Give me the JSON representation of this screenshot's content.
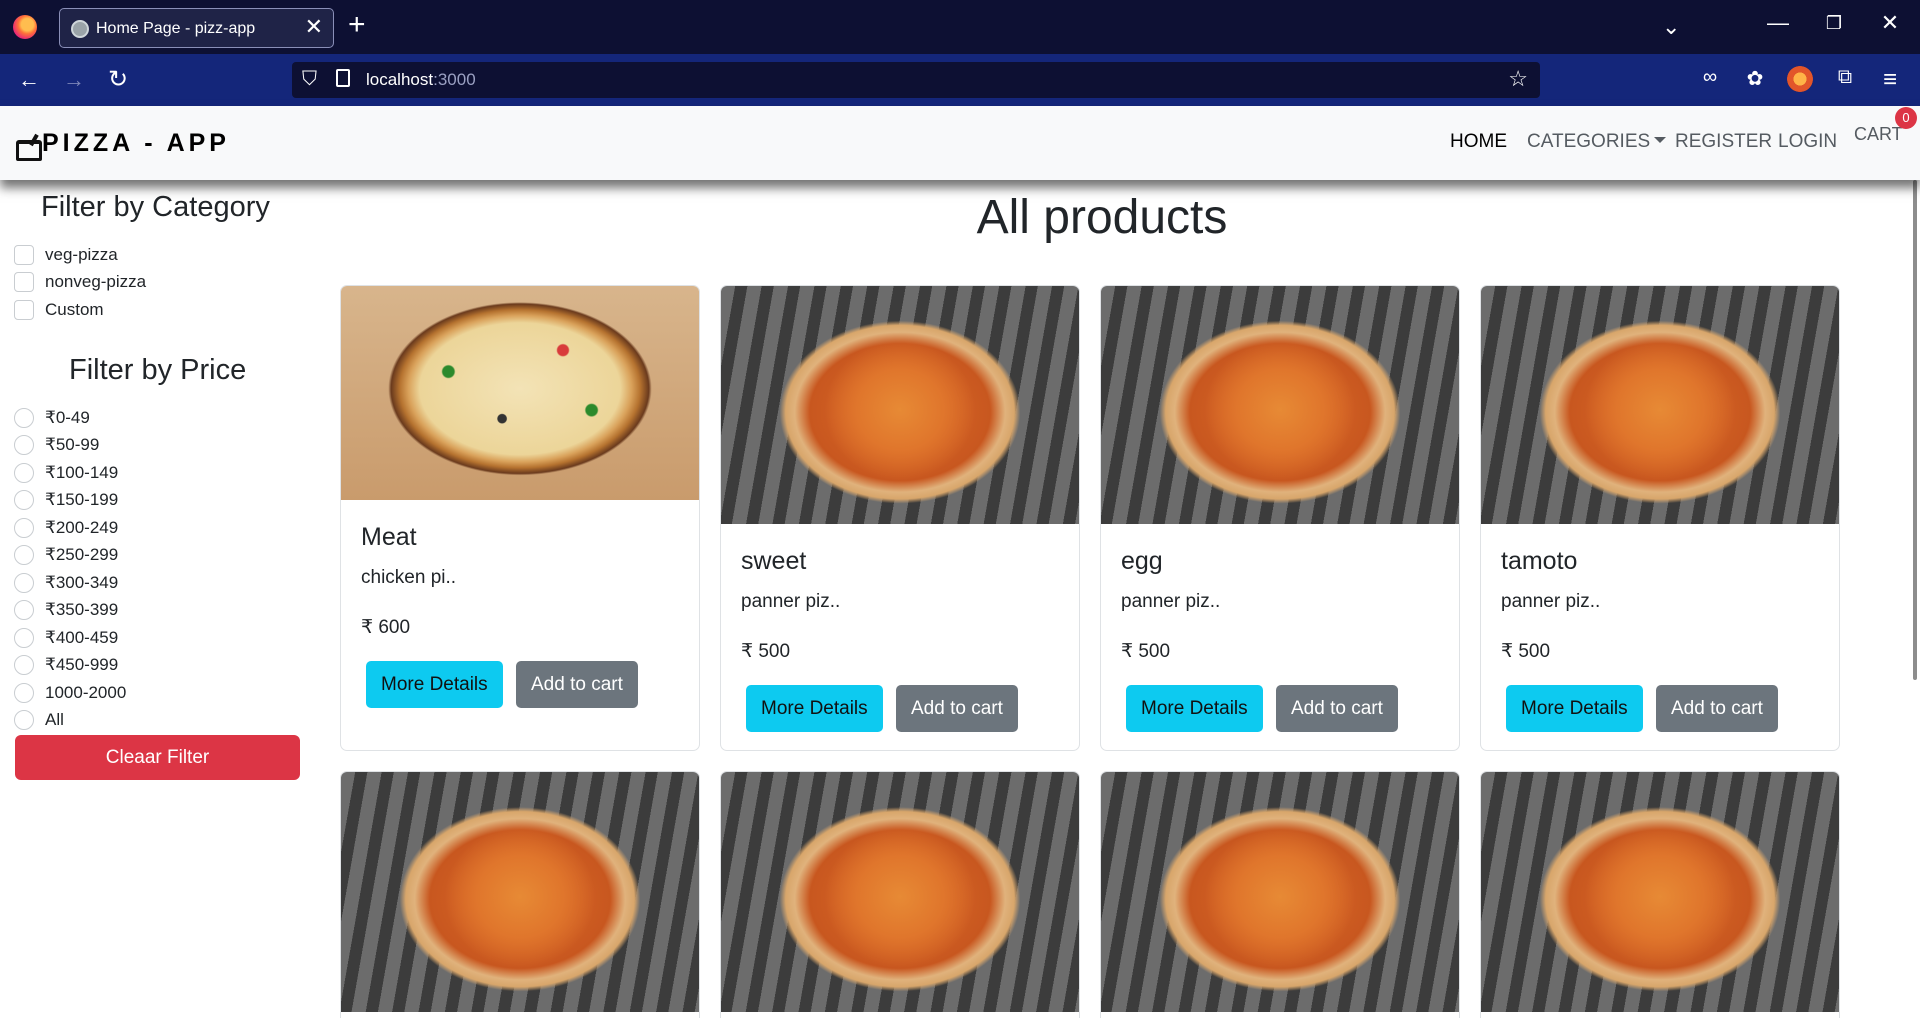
{
  "browser": {
    "tab_title": "Home Page - pizz-app",
    "tab_close": "✕",
    "new_tab": "+",
    "list_tabs": "⌄",
    "window_minimize": "—",
    "window_restore": "❐",
    "window_close": "✕",
    "back": "←",
    "forward": "→",
    "reload": "↻",
    "url_host": "localhost",
    "url_port": ":3000",
    "star": "☆",
    "menu": "≡",
    "icons": [
      "shield-icon",
      "page-icon",
      "bookmark-star-icon",
      "mask-icon",
      "cookie-icon",
      "fox-extension-icon",
      "puzzle-icon",
      "menu-icon"
    ]
  },
  "app": {
    "brand": "PIZZA - APP",
    "nav": {
      "home": "HOME",
      "categories": "CATEGORIES",
      "register": "REGISTER",
      "login": "LOGIN",
      "cart": "CART",
      "cart_count": "0"
    }
  },
  "sidebar": {
    "category_title": "Filter by Category",
    "categories": [
      "veg-pizza",
      "nonveg-pizza",
      "Custom"
    ],
    "price_title": "Filter by Price",
    "prices": [
      "₹0-49",
      "₹50-99",
      "₹100-149",
      "₹150-199",
      "₹200-249",
      "₹250-299",
      "₹300-349",
      "₹350-399",
      "₹400-459",
      "₹450-999",
      "1000-2000",
      "All"
    ],
    "clear_button": "Cleaar Filter"
  },
  "main": {
    "heading": "All products",
    "buttons": {
      "details": "More Details",
      "cart": "Add to cart"
    },
    "products": [
      {
        "name": "Meat",
        "desc": "chicken pi..",
        "price": "₹ 600"
      },
      {
        "name": "sweet",
        "desc": "panner piz..",
        "price": "₹ 500"
      },
      {
        "name": "egg",
        "desc": "panner piz..",
        "price": "₹ 500"
      },
      {
        "name": "tamoto",
        "desc": "panner piz..",
        "price": "₹ 500"
      }
    ]
  },
  "colors": {
    "tab_bar": "#0d1033",
    "nav_bar": "#14267a",
    "info_button": "#0dcaf0",
    "secondary_button": "#6c757d",
    "danger_button": "#dc3545"
  }
}
